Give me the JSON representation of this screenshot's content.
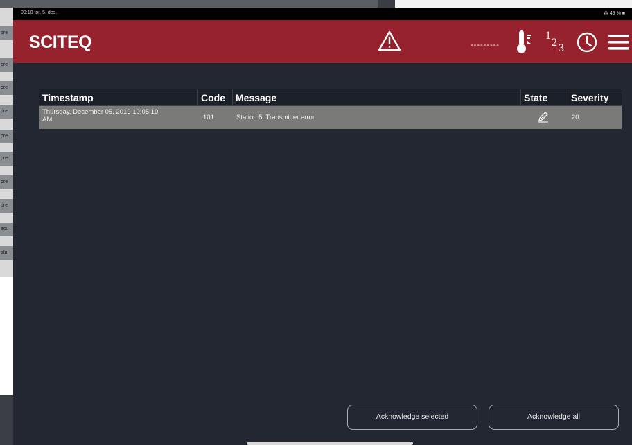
{
  "statusbar": {
    "left": "09:10  tor. 5. des.",
    "right": "⁂ 49 % ■"
  },
  "header": {
    "logo": "SCITEQ",
    "dash_indicator": "---------",
    "numeric_icon": {
      "a": "1",
      "b": "2",
      "c": "3"
    }
  },
  "table": {
    "columns": {
      "timestamp": "Timestamp",
      "code": "Code",
      "message": "Message",
      "state": "State",
      "severity": "Severity"
    },
    "rows": [
      {
        "timestamp_line1": "Thursday, December 05, 2019 10:05:10",
        "timestamp_line2": "AM",
        "code": "101",
        "message": "Station 5: Transmitter error",
        "state_icon": "pencil-icon",
        "severity": "20"
      }
    ]
  },
  "buttons": {
    "ack_selected": "Acknowledge selected",
    "ack_all": "Acknowledge all"
  },
  "background_app": {
    "items": [
      "pre",
      "pre",
      "pre",
      "pre",
      "pre",
      "pre",
      "pre",
      "pre",
      "esu",
      "sta",
      "..."
    ]
  },
  "colors": {
    "header_red": "#95222c",
    "screen_bg": "#222731",
    "row_bg": "#7a7a78"
  }
}
